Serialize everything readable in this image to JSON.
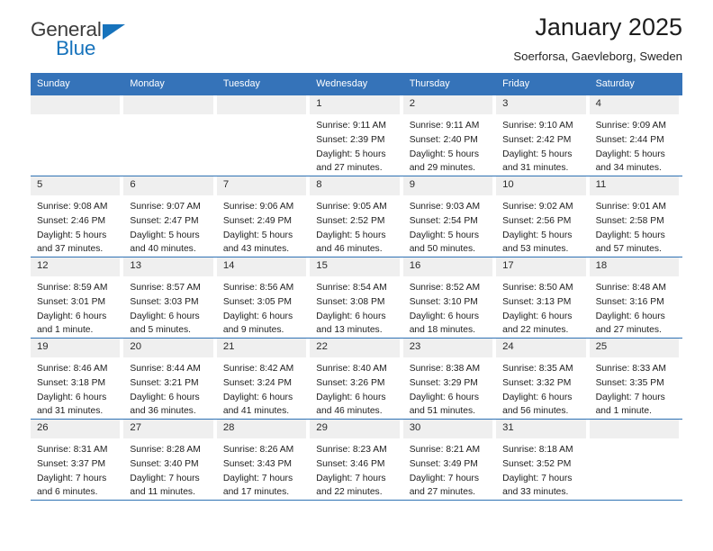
{
  "brand": {
    "word1": "General",
    "word2": "Blue",
    "triangle_color": "#1773bc"
  },
  "header": {
    "title": "January 2025",
    "subtitle": "Soerforsa, Gaevleborg, Sweden"
  },
  "colors": {
    "header_blue": "#3573b9",
    "row_divider": "#2f72b4",
    "daynum_band": "#efefef"
  },
  "weekdays": [
    "Sunday",
    "Monday",
    "Tuesday",
    "Wednesday",
    "Thursday",
    "Friday",
    "Saturday"
  ],
  "weeks": [
    [
      {
        "day": "",
        "empty": true
      },
      {
        "day": "",
        "empty": true
      },
      {
        "day": "",
        "empty": true
      },
      {
        "day": "1",
        "sunrise": "Sunrise: 9:11 AM",
        "sunset": "Sunset: 2:39 PM",
        "daylight1": "Daylight: 5 hours",
        "daylight2": "and 27 minutes."
      },
      {
        "day": "2",
        "sunrise": "Sunrise: 9:11 AM",
        "sunset": "Sunset: 2:40 PM",
        "daylight1": "Daylight: 5 hours",
        "daylight2": "and 29 minutes."
      },
      {
        "day": "3",
        "sunrise": "Sunrise: 9:10 AM",
        "sunset": "Sunset: 2:42 PM",
        "daylight1": "Daylight: 5 hours",
        "daylight2": "and 31 minutes."
      },
      {
        "day": "4",
        "sunrise": "Sunrise: 9:09 AM",
        "sunset": "Sunset: 2:44 PM",
        "daylight1": "Daylight: 5 hours",
        "daylight2": "and 34 minutes."
      }
    ],
    [
      {
        "day": "5",
        "sunrise": "Sunrise: 9:08 AM",
        "sunset": "Sunset: 2:46 PM",
        "daylight1": "Daylight: 5 hours",
        "daylight2": "and 37 minutes."
      },
      {
        "day": "6",
        "sunrise": "Sunrise: 9:07 AM",
        "sunset": "Sunset: 2:47 PM",
        "daylight1": "Daylight: 5 hours",
        "daylight2": "and 40 minutes."
      },
      {
        "day": "7",
        "sunrise": "Sunrise: 9:06 AM",
        "sunset": "Sunset: 2:49 PM",
        "daylight1": "Daylight: 5 hours",
        "daylight2": "and 43 minutes."
      },
      {
        "day": "8",
        "sunrise": "Sunrise: 9:05 AM",
        "sunset": "Sunset: 2:52 PM",
        "daylight1": "Daylight: 5 hours",
        "daylight2": "and 46 minutes."
      },
      {
        "day": "9",
        "sunrise": "Sunrise: 9:03 AM",
        "sunset": "Sunset: 2:54 PM",
        "daylight1": "Daylight: 5 hours",
        "daylight2": "and 50 minutes."
      },
      {
        "day": "10",
        "sunrise": "Sunrise: 9:02 AM",
        "sunset": "Sunset: 2:56 PM",
        "daylight1": "Daylight: 5 hours",
        "daylight2": "and 53 minutes."
      },
      {
        "day": "11",
        "sunrise": "Sunrise: 9:01 AM",
        "sunset": "Sunset: 2:58 PM",
        "daylight1": "Daylight: 5 hours",
        "daylight2": "and 57 minutes."
      }
    ],
    [
      {
        "day": "12",
        "sunrise": "Sunrise: 8:59 AM",
        "sunset": "Sunset: 3:01 PM",
        "daylight1": "Daylight: 6 hours",
        "daylight2": "and 1 minute."
      },
      {
        "day": "13",
        "sunrise": "Sunrise: 8:57 AM",
        "sunset": "Sunset: 3:03 PM",
        "daylight1": "Daylight: 6 hours",
        "daylight2": "and 5 minutes."
      },
      {
        "day": "14",
        "sunrise": "Sunrise: 8:56 AM",
        "sunset": "Sunset: 3:05 PM",
        "daylight1": "Daylight: 6 hours",
        "daylight2": "and 9 minutes."
      },
      {
        "day": "15",
        "sunrise": "Sunrise: 8:54 AM",
        "sunset": "Sunset: 3:08 PM",
        "daylight1": "Daylight: 6 hours",
        "daylight2": "and 13 minutes."
      },
      {
        "day": "16",
        "sunrise": "Sunrise: 8:52 AM",
        "sunset": "Sunset: 3:10 PM",
        "daylight1": "Daylight: 6 hours",
        "daylight2": "and 18 minutes."
      },
      {
        "day": "17",
        "sunrise": "Sunrise: 8:50 AM",
        "sunset": "Sunset: 3:13 PM",
        "daylight1": "Daylight: 6 hours",
        "daylight2": "and 22 minutes."
      },
      {
        "day": "18",
        "sunrise": "Sunrise: 8:48 AM",
        "sunset": "Sunset: 3:16 PM",
        "daylight1": "Daylight: 6 hours",
        "daylight2": "and 27 minutes."
      }
    ],
    [
      {
        "day": "19",
        "sunrise": "Sunrise: 8:46 AM",
        "sunset": "Sunset: 3:18 PM",
        "daylight1": "Daylight: 6 hours",
        "daylight2": "and 31 minutes."
      },
      {
        "day": "20",
        "sunrise": "Sunrise: 8:44 AM",
        "sunset": "Sunset: 3:21 PM",
        "daylight1": "Daylight: 6 hours",
        "daylight2": "and 36 minutes."
      },
      {
        "day": "21",
        "sunrise": "Sunrise: 8:42 AM",
        "sunset": "Sunset: 3:24 PM",
        "daylight1": "Daylight: 6 hours",
        "daylight2": "and 41 minutes."
      },
      {
        "day": "22",
        "sunrise": "Sunrise: 8:40 AM",
        "sunset": "Sunset: 3:26 PM",
        "daylight1": "Daylight: 6 hours",
        "daylight2": "and 46 minutes."
      },
      {
        "day": "23",
        "sunrise": "Sunrise: 8:38 AM",
        "sunset": "Sunset: 3:29 PM",
        "daylight1": "Daylight: 6 hours",
        "daylight2": "and 51 minutes."
      },
      {
        "day": "24",
        "sunrise": "Sunrise: 8:35 AM",
        "sunset": "Sunset: 3:32 PM",
        "daylight1": "Daylight: 6 hours",
        "daylight2": "and 56 minutes."
      },
      {
        "day": "25",
        "sunrise": "Sunrise: 8:33 AM",
        "sunset": "Sunset: 3:35 PM",
        "daylight1": "Daylight: 7 hours",
        "daylight2": "and 1 minute."
      }
    ],
    [
      {
        "day": "26",
        "sunrise": "Sunrise: 8:31 AM",
        "sunset": "Sunset: 3:37 PM",
        "daylight1": "Daylight: 7 hours",
        "daylight2": "and 6 minutes."
      },
      {
        "day": "27",
        "sunrise": "Sunrise: 8:28 AM",
        "sunset": "Sunset: 3:40 PM",
        "daylight1": "Daylight: 7 hours",
        "daylight2": "and 11 minutes."
      },
      {
        "day": "28",
        "sunrise": "Sunrise: 8:26 AM",
        "sunset": "Sunset: 3:43 PM",
        "daylight1": "Daylight: 7 hours",
        "daylight2": "and 17 minutes."
      },
      {
        "day": "29",
        "sunrise": "Sunrise: 8:23 AM",
        "sunset": "Sunset: 3:46 PM",
        "daylight1": "Daylight: 7 hours",
        "daylight2": "and 22 minutes."
      },
      {
        "day": "30",
        "sunrise": "Sunrise: 8:21 AM",
        "sunset": "Sunset: 3:49 PM",
        "daylight1": "Daylight: 7 hours",
        "daylight2": "and 27 minutes."
      },
      {
        "day": "31",
        "sunrise": "Sunrise: 8:18 AM",
        "sunset": "Sunset: 3:52 PM",
        "daylight1": "Daylight: 7 hours",
        "daylight2": "and 33 minutes."
      },
      {
        "day": "",
        "empty": true
      }
    ]
  ]
}
